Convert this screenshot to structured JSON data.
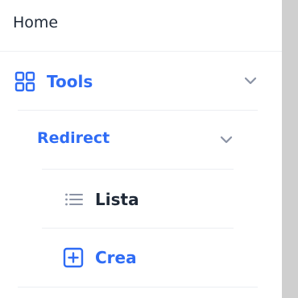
{
  "sidebar": {
    "home_label": "Home",
    "tools": {
      "label": "Tools",
      "icon": "grid-icon",
      "expanded": true,
      "children": [
        {
          "label": "Redirect",
          "expanded": true,
          "children": [
            {
              "label": "Lista",
              "icon": "list-icon"
            },
            {
              "label": "Crea",
              "icon": "plus-square-icon"
            }
          ]
        }
      ]
    }
  },
  "colors": {
    "accent": "#2f6cf5",
    "text": "#1f2937",
    "muted_icon": "#8b93a5",
    "divider": "#eceef2",
    "scrollbar": "#cfcfcf"
  }
}
